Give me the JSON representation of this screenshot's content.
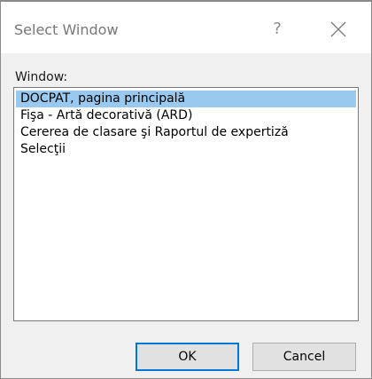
{
  "window": {
    "title": "Select Window",
    "help_glyph": "?",
    "help_icon": "question-mark-icon",
    "close_icon": "close-icon"
  },
  "content": {
    "field_label": "Window:",
    "items": [
      {
        "label": "DOCPAT, pagina principală",
        "selected": true
      },
      {
        "label": "Fişa - Artă decorativă (ARD)",
        "selected": false
      },
      {
        "label": "Cererea de clasare şi Raportul de expertiză",
        "selected": false
      },
      {
        "label": "Selecţii",
        "selected": false
      }
    ]
  },
  "buttons": {
    "ok_label": "OK",
    "cancel_label": "Cancel"
  },
  "colors": {
    "selection": "#99c9ef",
    "default_button_border": "#0078d7"
  }
}
